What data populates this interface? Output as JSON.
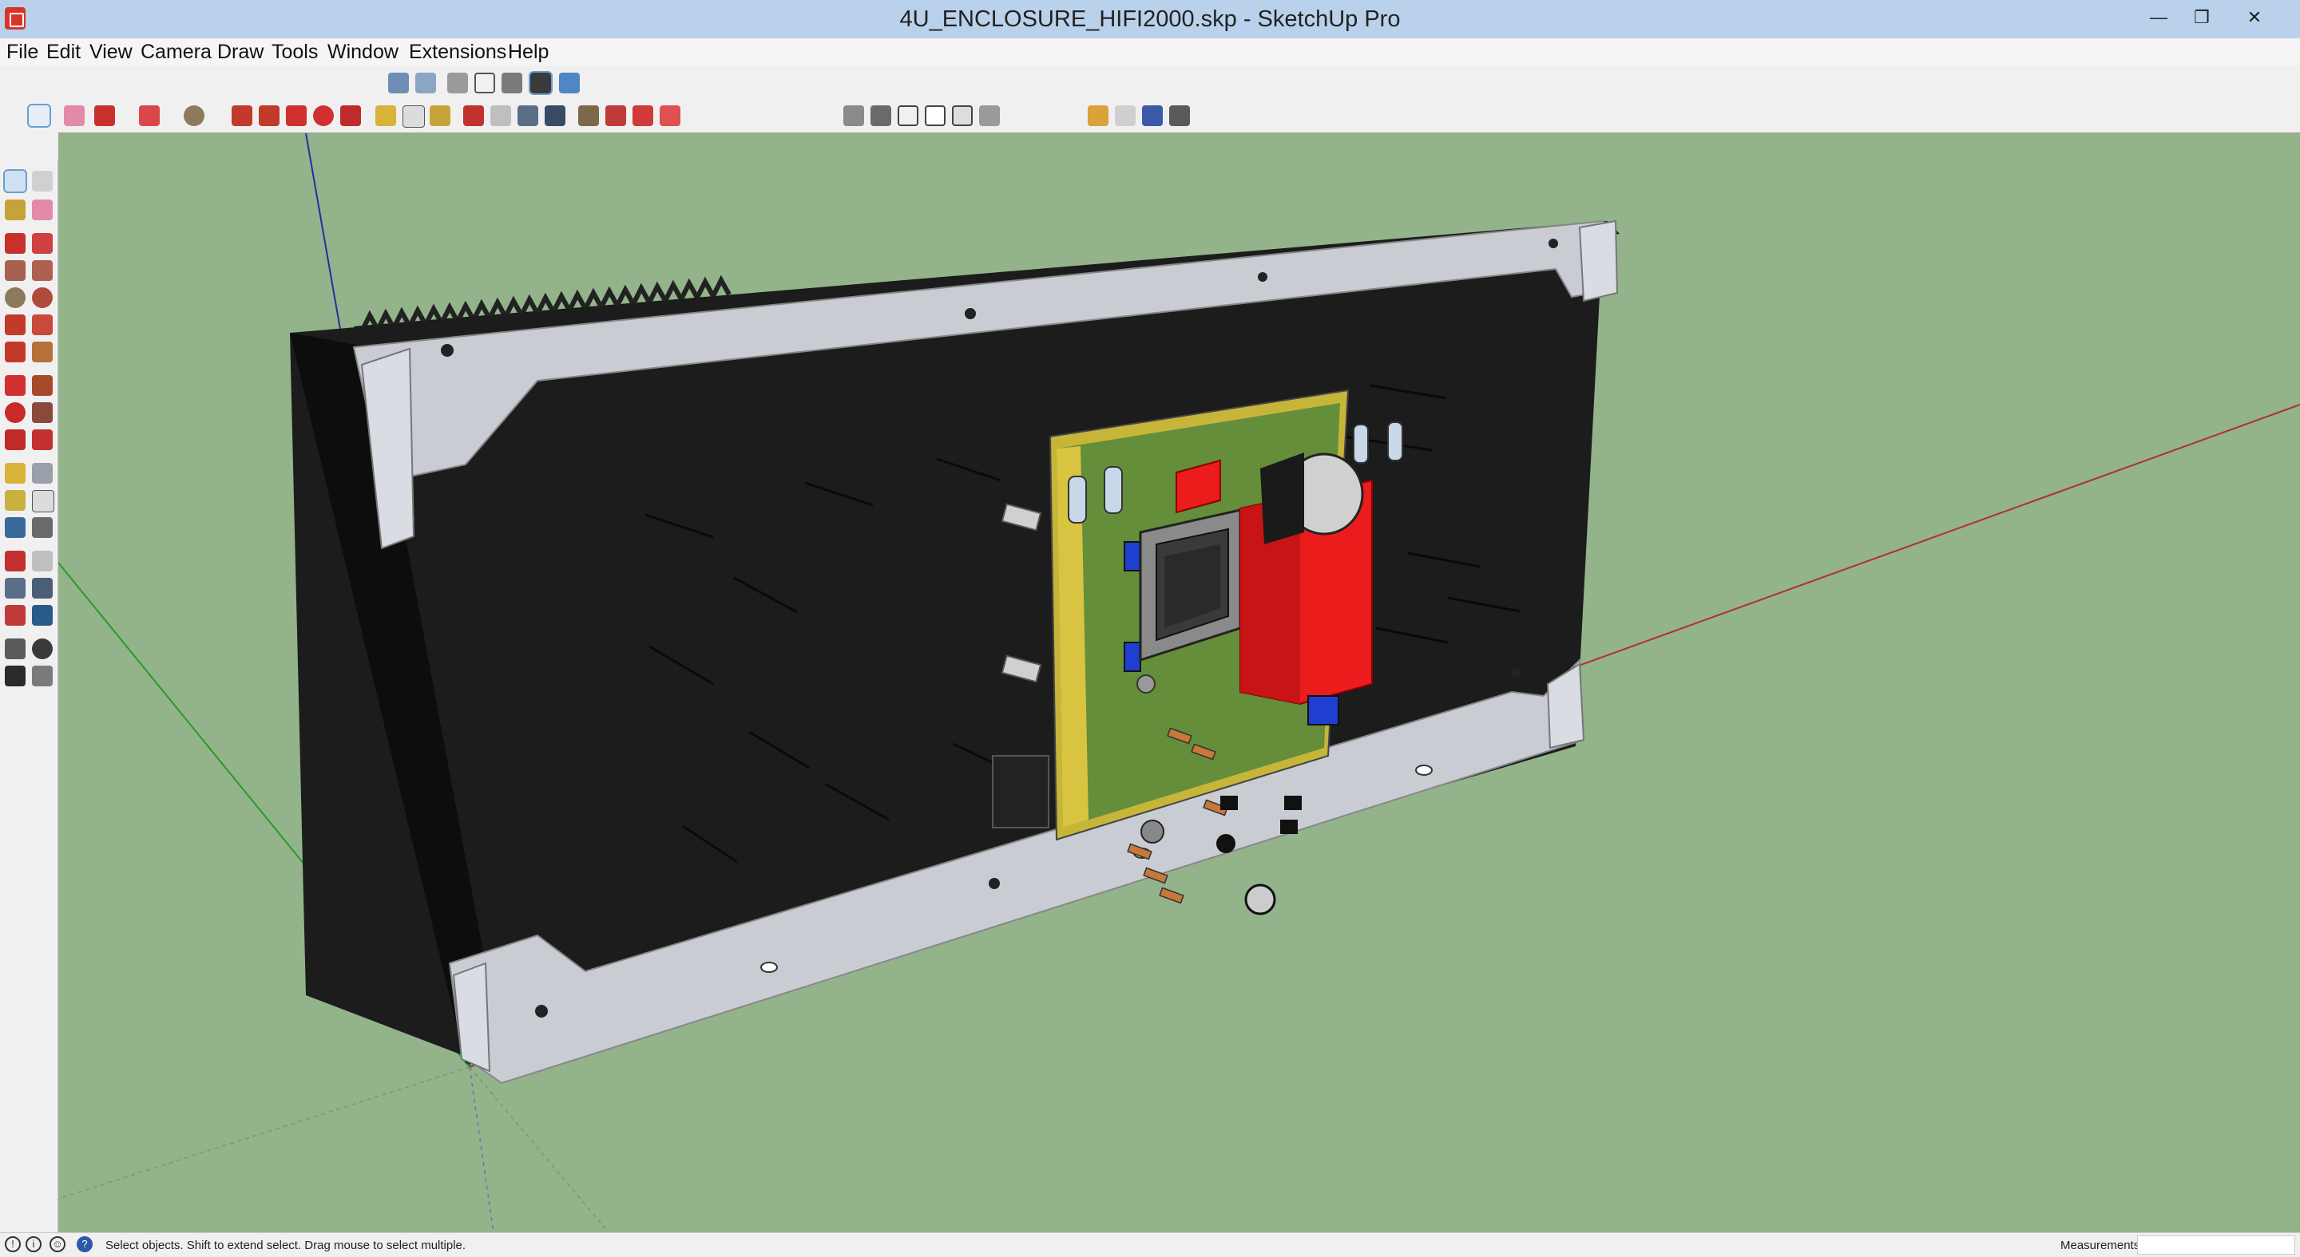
{
  "window": {
    "title": "4U_ENCLOSURE_HIFI2000.skp - SketchUp Pro",
    "minimize_icon": "minimize-icon",
    "restore_icon": "restore-icon",
    "close_icon": "close-icon",
    "minimize_glyph": "—",
    "restore_glyph": "❐",
    "close_glyph": "✕"
  },
  "menu": [
    "File",
    "Edit",
    "View",
    "Camera",
    "Draw",
    "Tools",
    "Window",
    "Extensions",
    "Help"
  ],
  "toolbars": {
    "views": [
      "iso-view-icon",
      "top-view-icon",
      "front-view-icon",
      "right-view-icon",
      "back-view-icon",
      "left-view-icon",
      "shaded-textures-icon",
      "monochrome-icon"
    ],
    "main": [
      "select-icon",
      "eraser-icon",
      "line-icon",
      "arc-icon",
      "circle-icon",
      "push-pull-icon",
      "follow-me-icon",
      "move-icon",
      "rotate-icon",
      "scale-icon",
      "tape-measure-icon",
      "text-icon",
      "paint-bucket-icon",
      "orbit-icon",
      "pan-icon",
      "zoom-icon",
      "zoom-extents-icon",
      "warehouse-icon",
      "extension-warehouse-icon",
      "layout-icon"
    ],
    "styles": [
      "xray-icon",
      "back-edges-icon",
      "wireframe-icon",
      "hidden-line-icon",
      "shaded-icon",
      "textured-icon"
    ],
    "extras": [
      "sandbox-icon",
      "solid-tools-icon",
      "dynamic-components-icon",
      "camera-icon"
    ]
  },
  "left_toolbar": [
    "select-icon",
    "make-component-icon",
    "paint-bucket-icon",
    "eraser-icon",
    "line-icon",
    "freehand-icon",
    "rectangle-icon",
    "rotated-rectangle-icon",
    "circle-icon",
    "polygon-icon",
    "arc-icon",
    "three-point-arc-icon",
    "pie-icon",
    "offset-icon",
    "move-icon",
    "push-pull-icon",
    "rotate-icon",
    "follow-me-icon",
    "scale-icon",
    "offset-2-icon",
    "tape-measure-icon",
    "dimension-icon",
    "protractor-icon",
    "text-icon",
    "axes-icon",
    "3d-text-icon",
    "orbit-icon",
    "pan-icon",
    "zoom-icon",
    "zoom-window-icon",
    "zoom-extents-icon",
    "previous-view-icon",
    "position-camera-icon",
    "look-around-icon",
    "walk-icon",
    "section-plane-icon"
  ],
  "status": {
    "text": "Select objects. Shift to extend select. Drag mouse to select multiple.",
    "measurements_label": "Measurements",
    "icons": [
      "geo-location-icon",
      "credits-icon",
      "user-icon",
      "help-icon"
    ],
    "icon_glyphs": [
      "!",
      "i",
      "☺",
      "?"
    ]
  },
  "colors": {
    "accent_blue": "#6a9fd0",
    "viewport_green": "#93b38a",
    "pcb_green": "#2f7a3a",
    "capacitor_red": "#ea1c1c",
    "enclosure_black": "#1d1d1d",
    "bracket_grey": "#c9ccd3"
  }
}
